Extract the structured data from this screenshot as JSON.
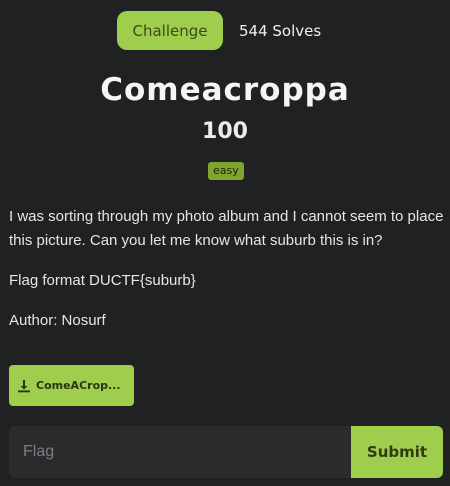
{
  "tabs": {
    "challenge_label": "Challenge",
    "solves_label": "544 Solves"
  },
  "challenge": {
    "title": "Comeacroppa",
    "points": "100",
    "difficulty": "easy",
    "description": [
      "I was sorting through my photo album and I cannot seem to place this picture. Can you let me know what suburb this is in?",
      "Flag format DUCTF{suburb}",
      "Author: Nosurf"
    ]
  },
  "file": {
    "icon": "download-icon",
    "label": "ComeACrop..."
  },
  "flag_form": {
    "placeholder": "Flag",
    "value": "",
    "submit_label": "Submit"
  },
  "colors": {
    "background": "#202123",
    "accent": "#9fcd4d",
    "difficulty_badge": "#7fa531",
    "input_background": "#2a2b2d"
  }
}
